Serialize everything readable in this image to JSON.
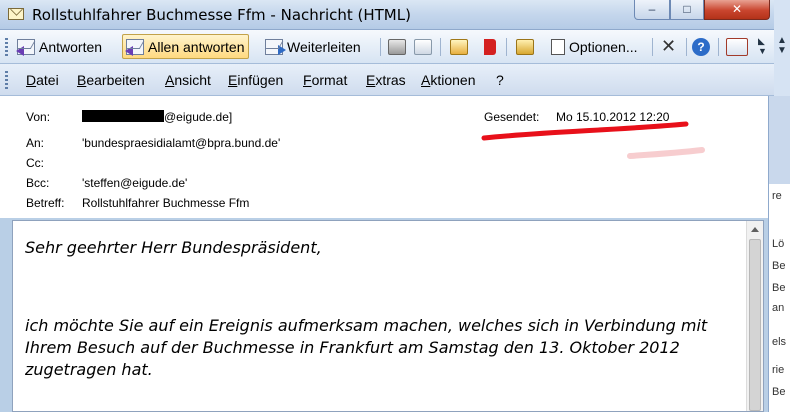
{
  "window": {
    "title": "Rollstuhlfahrer Buchmesse Ffm - Nachricht (HTML)",
    "minimize": "–",
    "maximize": "□",
    "close": "✕"
  },
  "toolbar": {
    "reply": "Antworten",
    "reply_all": "Allen antworten",
    "forward": "Weiterleiten",
    "options": "Optionen...",
    "delete_glyph": "✕",
    "help_glyph": "?"
  },
  "menu": [
    "Datei",
    "Bearbeiten",
    "Ansicht",
    "Einfügen",
    "Format",
    "Extras",
    "Aktionen",
    "?"
  ],
  "header": {
    "from_label": "Von:",
    "from_value": "@eigude.de]",
    "to_label": "An:",
    "to_value": "'bundespraesidialamt@bpra.bund.de'",
    "cc_label": "Cc:",
    "cc_value": "",
    "bcc_label": "Bcc:",
    "bcc_value": "'steffen@eigude.de'",
    "subject_label": "Betreff:",
    "subject_value": "Rollstuhlfahrer Buchmesse Ffm",
    "sent_label": "Gesendet:",
    "sent_value": "Mo 15.10.2012 12:20"
  },
  "body": {
    "greeting": "Sehr geehrter Herr Bundespräsident,",
    "paragraph": "ich möchte Sie auf ein Ereignis aufmerksam machen, welches sich in Verbindung mit Ihrem Besuch auf der Buchmesse in Frankfurt am Samstag den 13. Oktober 2012 zugetragen hat."
  },
  "background_window": {
    "snippets": [
      "re",
      "Lö",
      "Be",
      "Be",
      "an",
      "els",
      "rie",
      "Be"
    ]
  },
  "colors": {
    "titlebar": "#c4d6ec",
    "active_button": "#ffd980",
    "annotation": "#e8101a"
  }
}
